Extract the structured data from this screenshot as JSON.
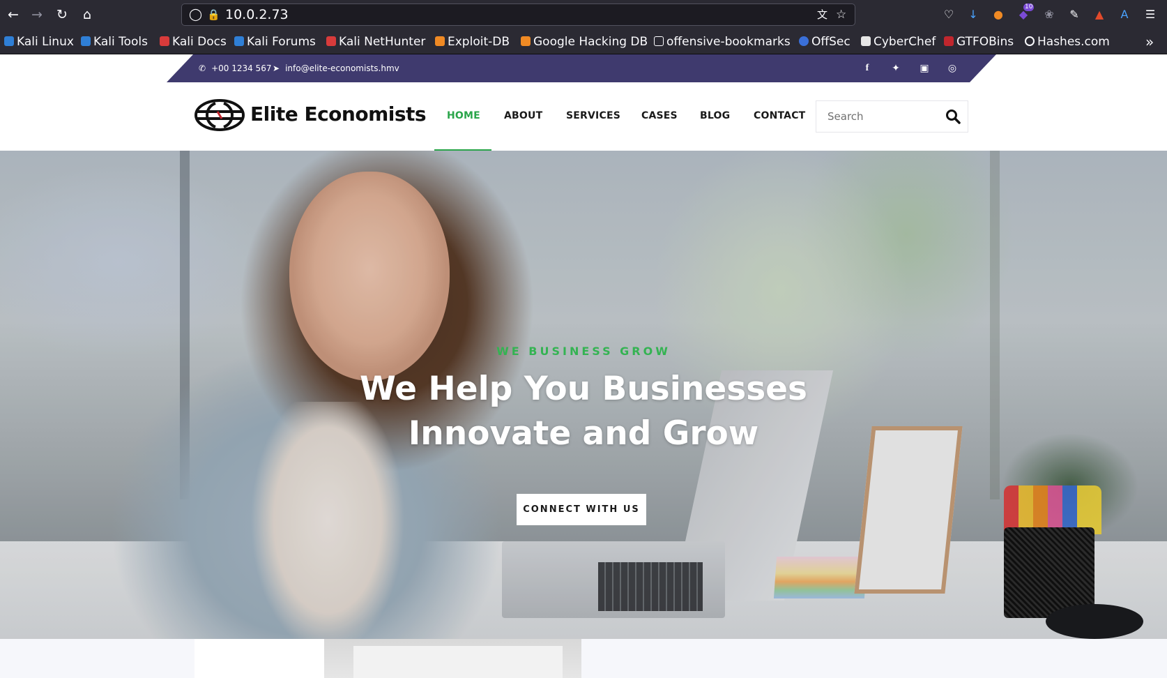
{
  "browser": {
    "url": "10.0.2.73",
    "bookmarks": [
      {
        "label": "Kali Linux",
        "color": "#2f7fd6"
      },
      {
        "label": "Kali Tools",
        "color": "#2f7fd6"
      },
      {
        "label": "Kali Docs",
        "color": "#d83b3b"
      },
      {
        "label": "Kali Forums",
        "color": "#2f7fd6"
      },
      {
        "label": "Kali NetHunter",
        "color": "#d83b3b"
      },
      {
        "label": "Exploit-DB",
        "color": "#f08a24"
      },
      {
        "label": "Google Hacking DB",
        "color": "#f08a24"
      },
      {
        "label": "offensive-bookmarks",
        "color": "#2b2a33"
      },
      {
        "label": "OffSec",
        "color": "#3a6fd8"
      },
      {
        "label": "CyberChef",
        "color": "#e6e6e6"
      },
      {
        "label": "GTFOBins",
        "color": "#c0262d"
      },
      {
        "label": "Hashes.com",
        "color": "#ffffff"
      }
    ],
    "extension_badge": "10"
  },
  "topbar": {
    "phone": "+00 1234 567",
    "email": "info@elite-economists.hmv",
    "social": [
      "facebook",
      "twitter",
      "instagram",
      "dribbble"
    ]
  },
  "header": {
    "logo_text": "Elite Economists",
    "menu": [
      "HOME",
      "ABOUT",
      "SERVICES",
      "CASES",
      "BLOG",
      "CONTACT"
    ],
    "active_menu": "HOME",
    "search_placeholder": "Search"
  },
  "hero": {
    "kicker": "WE BUSINESS GROW",
    "title_line1": "We Help You Businesses",
    "title_line2": "Innovate and Grow",
    "cta_label": "CONNECT WITH US",
    "slide_count": 3,
    "active_slide": 1
  },
  "colors": {
    "brand_purple": "#3f3a6e",
    "accent_green": "#2aa54a",
    "browser_bg": "#2b2a33"
  }
}
